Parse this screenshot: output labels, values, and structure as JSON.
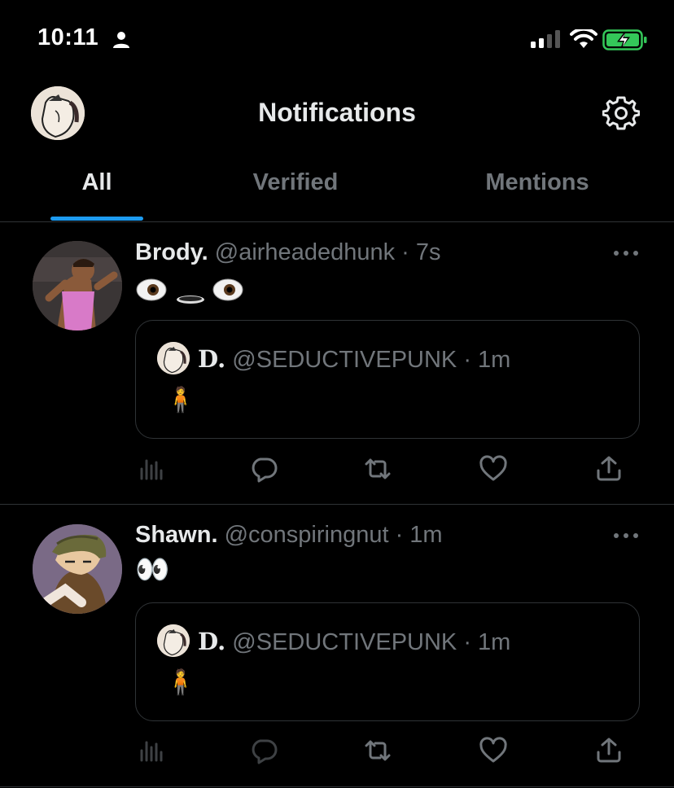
{
  "status_bar": {
    "time": "10:11"
  },
  "header": {
    "title": "Notifications"
  },
  "tabs": [
    {
      "label": "All",
      "active": true
    },
    {
      "label": "Verified",
      "active": false
    },
    {
      "label": "Mentions",
      "active": false
    }
  ],
  "tweets": [
    {
      "name": "Brody.",
      "handle": "@airheadedhunk",
      "time": "· 7s",
      "content_emoji": [
        "eyes-left",
        "mouth",
        "eyes-right"
      ],
      "quote": {
        "name": "D.",
        "handle": "@SEDUCTIVEPUNK",
        "time": "· 1m",
        "content": "🧍"
      }
    },
    {
      "name": "Shawn.",
      "handle": "@conspiringnut",
      "time": "· 1m",
      "content": "👀",
      "quote": {
        "name": "D.",
        "handle": "@SEDUCTIVEPUNK",
        "time": "· 1m",
        "content": "🧍"
      }
    }
  ],
  "colors": {
    "accent": "#1d9bf0",
    "secondary_text": "#71767b",
    "primary_text": "#e7e9ea",
    "divider": "#2f3336",
    "battery": "#34c759"
  },
  "icons": [
    "person-icon",
    "signal-icon",
    "wifi-icon",
    "battery-charging-icon",
    "gear-icon",
    "more-icon",
    "views-icon",
    "reply-icon",
    "retweet-icon",
    "like-icon",
    "share-icon"
  ]
}
